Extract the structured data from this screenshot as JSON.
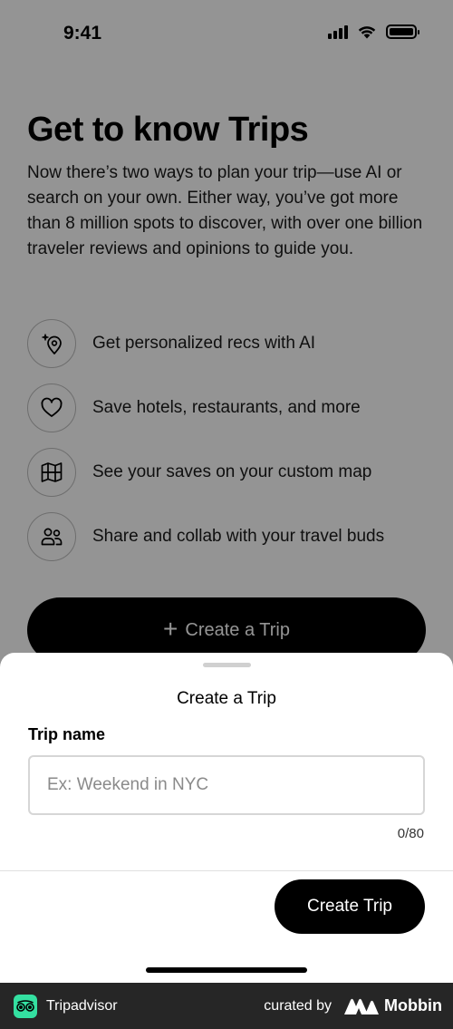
{
  "status_bar": {
    "time": "9:41"
  },
  "intro": {
    "title": "Get to know Trips",
    "description": "Now there’s two ways to plan your trip—use AI or search on your own. Either way, you’ve got more than 8 million spots to discover, with over one billion traveler reviews and opinions to guide you."
  },
  "features": [
    {
      "icon": "ai-location-icon",
      "label": "Get personalized recs with AI"
    },
    {
      "icon": "heart-icon",
      "label": "Save hotels, restaurants, and more"
    },
    {
      "icon": "map-icon",
      "label": "See your saves on your custom map"
    },
    {
      "icon": "people-icon",
      "label": "Share and collab with your travel buds"
    }
  ],
  "cta": {
    "label": "Create a Trip"
  },
  "sheet": {
    "title": "Create a Trip",
    "field_label": "Trip name",
    "input_value": "",
    "input_placeholder": "Ex: Weekend in NYC",
    "char_count": "0/80",
    "submit_label": "Create Trip"
  },
  "footer": {
    "brand": "Tripadvisor",
    "curated_by": "curated by",
    "curator": "Mobbin"
  },
  "colors": {
    "brand_green": "#34e0a1",
    "button_black": "#000000",
    "footer_bg": "#262626"
  }
}
